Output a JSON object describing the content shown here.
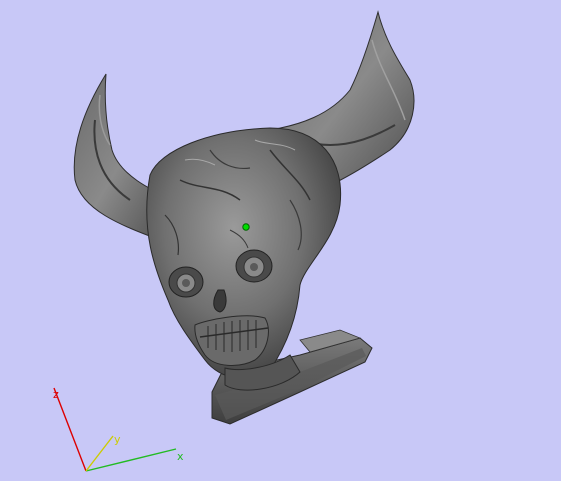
{
  "viewport": {
    "background": "#c8c8f7",
    "model": "horned-skull-bust"
  },
  "axes": {
    "x": {
      "label": "x",
      "color": "#22bb22"
    },
    "y": {
      "label": "y",
      "color": "#cccc00"
    },
    "z": {
      "label": "z",
      "color": "#dd0000"
    }
  },
  "marker": {
    "name": "pivot-point",
    "color": "#00dd00"
  }
}
